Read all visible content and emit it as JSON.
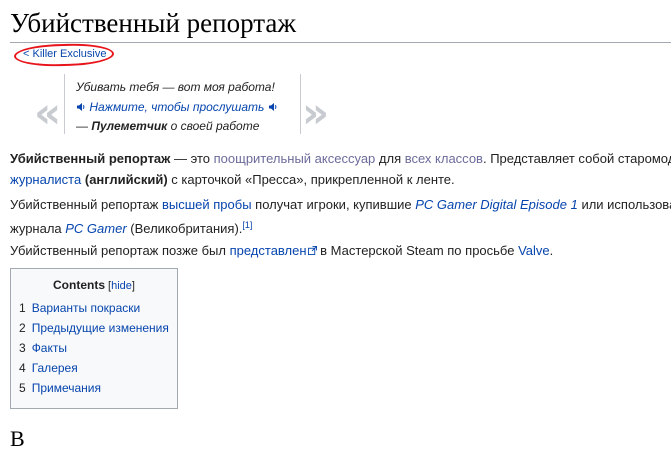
{
  "page": {
    "title": "Убийственный репортаж",
    "back_link": "< Killer Exclusive"
  },
  "quote": {
    "text": "Убивать тебя — вот моя работа!",
    "listen": "Нажмите, чтобы прослушать",
    "dash": "— ",
    "author": "Пулеметчик",
    "context": " о своей работе"
  },
  "para1": {
    "t1": "Убийственный репортаж",
    "t2": " — это ",
    "l1": "поощрительный аксессуар",
    "t3": " для ",
    "l2": "всех классов",
    "t4": ". Представляет собой старомодн",
    "l3": "журналиста",
    "t5": " ",
    "t6": "(английский)",
    "t7": " с карточкой «Пресса», прикрепленной к ленте."
  },
  "para2": {
    "t1": "Убийственный репортаж ",
    "l1": "высшей пробы",
    "t2": " получат игроки, купившие ",
    "l2": "PC Gamer Digital Episode 1",
    "t3": " или использовав",
    "t4": "журнала ",
    "l3": "PC Gamer",
    "t5": " (Великобритания).",
    "ref": "[1]"
  },
  "para3": {
    "t1": "Убийственный репортаж позже был ",
    "l1": "представлен",
    "t2": " в Мастерской Steam по просьбе ",
    "l2": "Valve",
    "t3": "."
  },
  "toc": {
    "title": "Contents",
    "hide_open": " [",
    "hide": "hide",
    "hide_close": "]",
    "items": [
      {
        "num": "1",
        "label": "Варианты покраски"
      },
      {
        "num": "2",
        "label": "Предыдущие изменения"
      },
      {
        "num": "3",
        "label": "Факты"
      },
      {
        "num": "4",
        "label": "Галерея"
      },
      {
        "num": "5",
        "label": "Примечания"
      }
    ]
  },
  "next_heading": "В",
  "colors": {
    "link": "#0645ad",
    "highlight_oval": "#e8141b",
    "quote_marks": "#c8ccd1"
  }
}
